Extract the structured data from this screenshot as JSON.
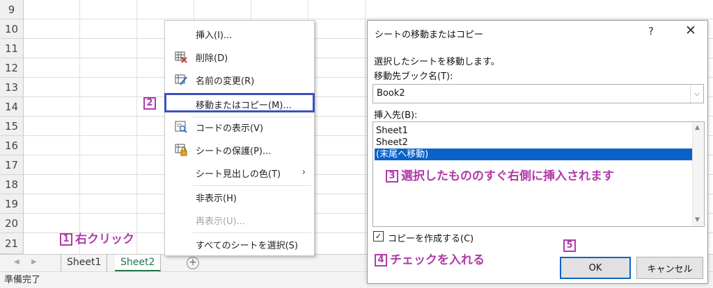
{
  "sheet": {
    "rows": [
      "9",
      "10",
      "11",
      "12",
      "13",
      "14",
      "15",
      "16",
      "17",
      "18",
      "19",
      "20",
      "21"
    ]
  },
  "tabs": {
    "prev": "◀",
    "next": "▶",
    "sheet1": "Sheet1",
    "sheet2": "Sheet2",
    "add": "+"
  },
  "status": "準備完了",
  "context_menu": {
    "items": [
      {
        "label": "挿入(I)...",
        "icon": "none"
      },
      {
        "label": "削除(D)",
        "icon": "delete-sheet-icon"
      },
      {
        "label": "名前の変更(R)",
        "icon": "rename-sheet-icon"
      },
      {
        "label": "移動またはコピー(M)...",
        "icon": "none"
      },
      {
        "label": "コードの表示(V)",
        "icon": "view-code-icon"
      },
      {
        "label": "シートの保護(P)...",
        "icon": "protect-sheet-icon"
      },
      {
        "label": "シート見出しの色(T)",
        "icon": "none"
      },
      {
        "label": "非表示(H)",
        "icon": "none"
      },
      {
        "label": "再表示(U)...",
        "icon": "none"
      },
      {
        "label": "すべてのシートを選択(S)",
        "icon": "none"
      }
    ],
    "submenu_arrow": "›"
  },
  "dialog": {
    "title": "シートの移動またはコピー",
    "help": "?",
    "close": "✕",
    "instruction": "選択したシートを移動します。",
    "book_label": "移動先ブック名(T):",
    "book_value": "Book2",
    "insert_label": "挿入先(B):",
    "list_items": [
      "Sheet1",
      "Sheet2",
      "(末尾へ移動)"
    ],
    "selected_index": 2,
    "copy_checkbox_label": "コピーを作成する(C)",
    "copy_checked": true,
    "ok": "OK",
    "cancel": "キャンセル"
  },
  "annotations": {
    "a1_num": "1",
    "a1_text": "右クリック",
    "a2_num": "2",
    "a3_num": "3",
    "a3_text": "選択したもののすぐ右側に挿入されます",
    "a4_num": "4",
    "a4_text": "チェックを入れる",
    "a5_num": "5"
  },
  "colors": {
    "accent": "#b03aa8",
    "highlight_box": "#3d4fbd",
    "selection": "#0a62c9",
    "active_tab": "#217346"
  }
}
